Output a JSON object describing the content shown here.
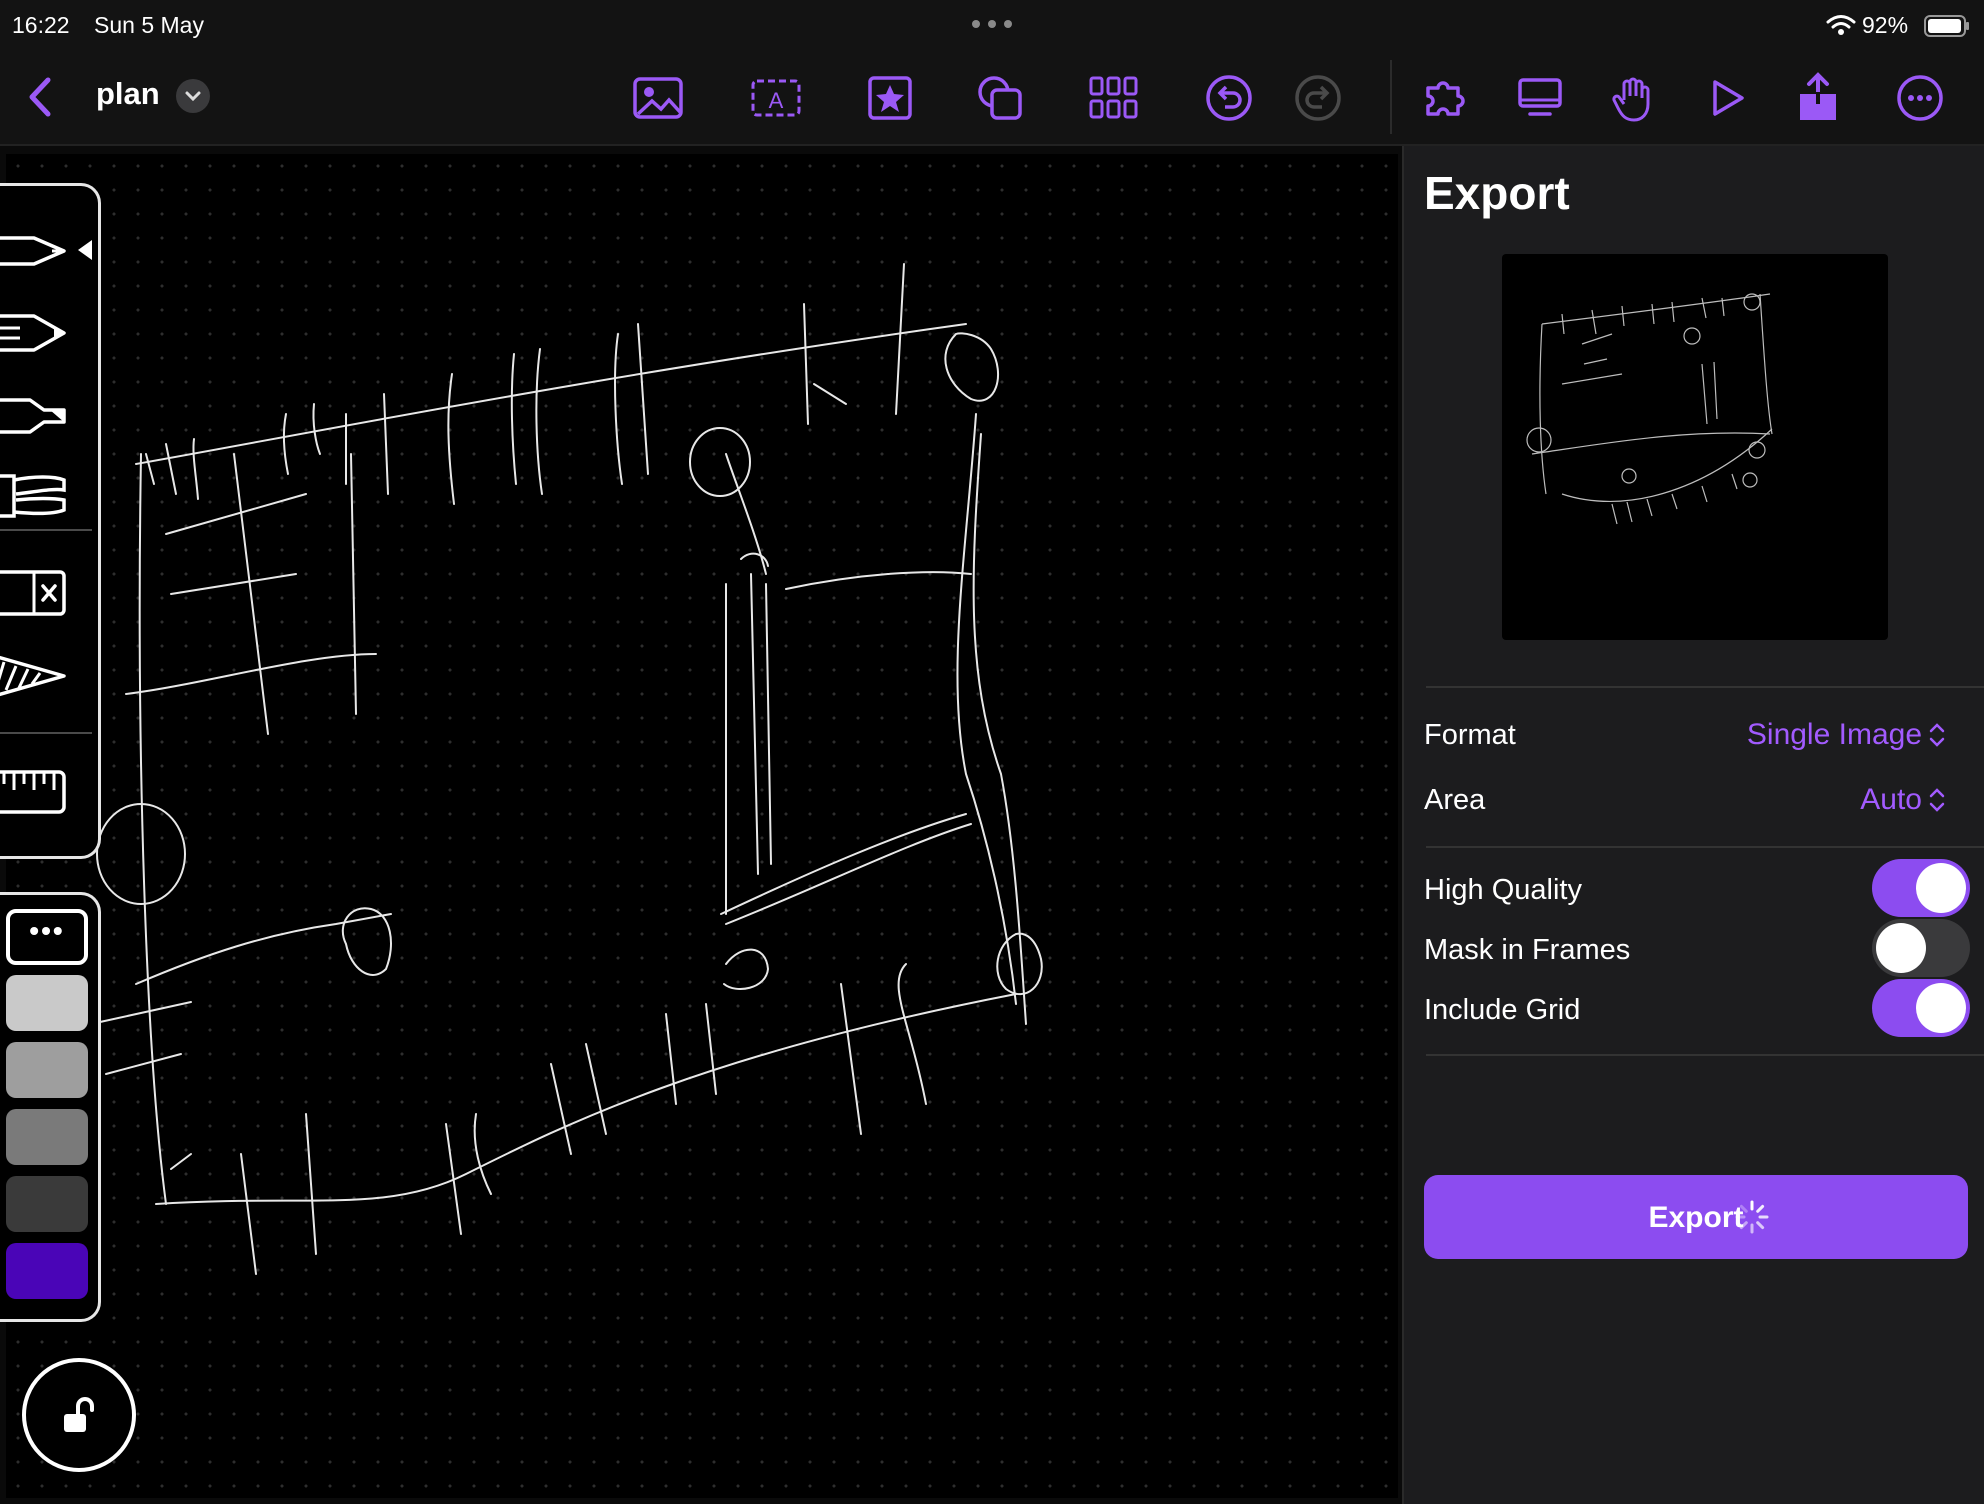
{
  "status_bar": {
    "time": "16:22",
    "date": "Sun 5 May",
    "battery": "92%",
    "icons": [
      "more-dots-icon",
      "wifi-icon",
      "battery-icon"
    ]
  },
  "toolbar": {
    "title": "plan",
    "icons": [
      "back-chevron-icon",
      "title-chevron-down-icon",
      "image-icon",
      "text-box-icon",
      "sticker-star-icon",
      "shapes-icon",
      "grid-icon",
      "undo-icon",
      "redo-icon",
      "puzzle-plugin-icon",
      "presentation-screen-icon",
      "hand-gesture-icon",
      "play-icon",
      "share-icon",
      "more-circle-icon"
    ]
  },
  "tools": {
    "items": [
      "pen-tool-icon",
      "pencil-tool-icon",
      "marker-tool-icon",
      "brush-tool-icon",
      "eraser-tool-icon",
      "lasso-fill-tool-icon",
      "ruler-tool-icon"
    ]
  },
  "colors": {
    "more_label": "•••",
    "swatches": [
      "#c9c9c9",
      "#9e9e9e",
      "#7a7a7a",
      "#3a3a3a",
      "#4a05b7"
    ]
  },
  "panel": {
    "title": "Export",
    "format_label": "Format",
    "format_value": "Single Image",
    "area_label": "Area",
    "area_value": "Auto",
    "high_quality_label": "High Quality",
    "high_quality_on": true,
    "mask_label": "Mask in Frames",
    "mask_on": false,
    "grid_label": "Include Grid",
    "grid_on": true,
    "export_button": "Export",
    "accent": "#8c4cf0"
  }
}
